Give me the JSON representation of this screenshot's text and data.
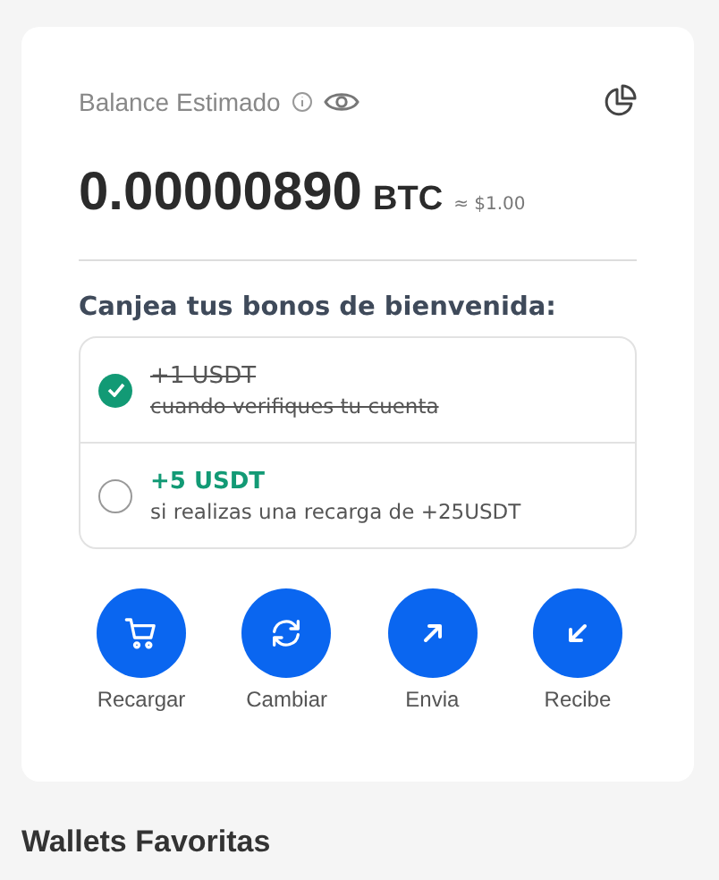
{
  "balance": {
    "label": "Balance Estimado",
    "amount": "0.00000890",
    "currency": "BTC",
    "fiat": "≈ $1.00"
  },
  "bonuses": {
    "title": "Canjea tus bonos de bienvenida:",
    "items": [
      {
        "amount": "+1 USDT",
        "condition": "cuando verifiques tu cuenta",
        "checked": true
      },
      {
        "amount": "+5 USDT",
        "condition": "si realizas una recarga de +25USDT",
        "checked": false
      }
    ]
  },
  "actions": [
    {
      "kind": "cart",
      "label": "Recargar"
    },
    {
      "kind": "swap",
      "label": "Cambiar"
    },
    {
      "kind": "send",
      "label": "Envia"
    },
    {
      "kind": "receive",
      "label": "Recibe"
    }
  ],
  "favorites_title": "Wallets Favoritas"
}
